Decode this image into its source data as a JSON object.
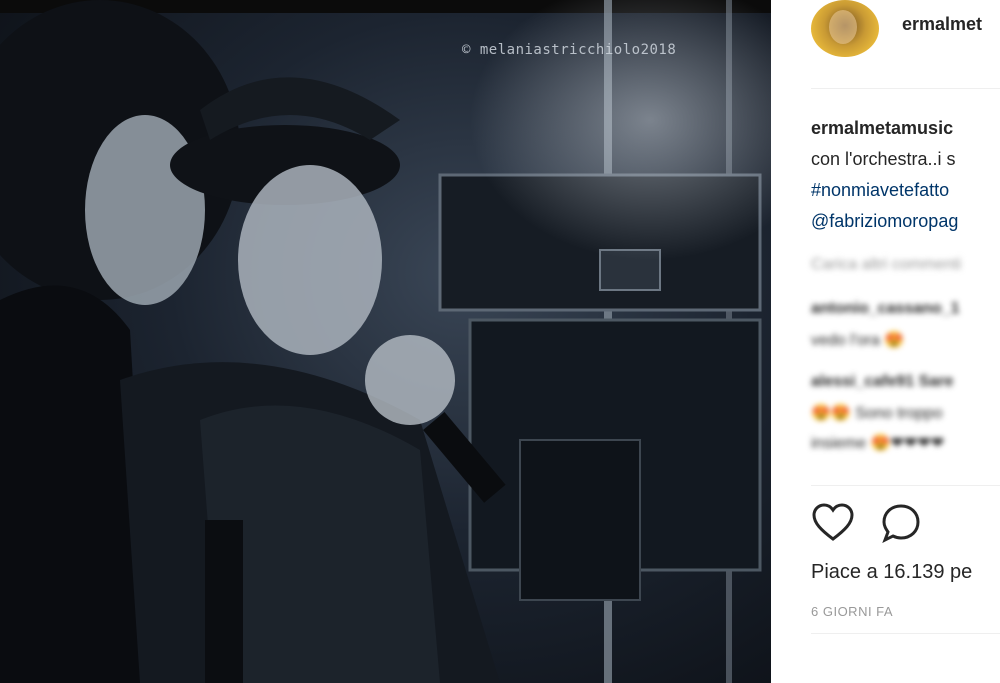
{
  "photo": {
    "watermark": "© melaniastricchiolo2018",
    "alt_subject": "two-singers-on-stage"
  },
  "post": {
    "username": "ermalmet",
    "caption_username": "ermalmetamusic",
    "caption_lines": [
      "con l'orchestra..i s",
      "#nonmiavetefatto",
      "@fabriziomoropag"
    ],
    "comments_blurred": [
      "Carica altri commenti",
      "antonio_cassano_1",
      "vedo l'ora 😍",
      "alessi_cafe91 Sare",
      "😍😍 Sono troppo",
      "insieme 😍❤❤❤❤"
    ],
    "likes_label": "Piace a 16.139 pe",
    "time_ago": "6 GIORNI FA"
  },
  "icons": {
    "like": "heart-icon",
    "comment": "comment-bubble-icon"
  },
  "colors": {
    "text": "#262626",
    "link": "#003569",
    "muted": "#999999",
    "divider": "#efefef"
  }
}
